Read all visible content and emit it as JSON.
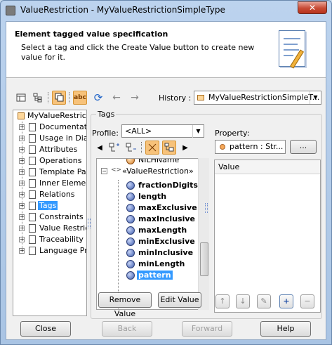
{
  "window": {
    "title": "ValueRestriction - MyValueRestrictionSimpleType",
    "close_glyph": "✕"
  },
  "header": {
    "title": "Element tagged value specification",
    "description": "Select a tag and click the Create Value button to create new value for it."
  },
  "toolbar": {
    "history_label": "History :",
    "history_value": "MyValueRestrictionSimpleT...",
    "abc_label": "abc"
  },
  "tree": {
    "root": "MyValueRestrictio",
    "items": [
      {
        "label": "Documentatio"
      },
      {
        "label": "Usage in Diag"
      },
      {
        "label": "Attributes"
      },
      {
        "label": "Operations"
      },
      {
        "label": "Template Para"
      },
      {
        "label": "Inner Element"
      },
      {
        "label": "Relations"
      },
      {
        "label": "Tags"
      },
      {
        "label": "Constraints"
      },
      {
        "label": "Value Restrict"
      },
      {
        "label": "Traceability"
      },
      {
        "label": "Language Pro"
      }
    ],
    "selected": "Tags"
  },
  "tags": {
    "group_title": "Tags",
    "profile_label": "Profile:",
    "profile_value": "<ALL>",
    "partial_item": "NILHName",
    "stereotype": "«ValueRestriction»",
    "items": [
      {
        "label": "fractionDigits"
      },
      {
        "label": "length"
      },
      {
        "label": "maxExclusive"
      },
      {
        "label": "maxInclusive"
      },
      {
        "label": "maxLength"
      },
      {
        "label": "minExclusive"
      },
      {
        "label": "minInclusive"
      },
      {
        "label": "minLength"
      },
      {
        "label": "pattern"
      }
    ],
    "selected": "pattern",
    "remove_button": "Remove Value",
    "edit_button": "Edit Value"
  },
  "property": {
    "label": "Property:",
    "value": "pattern : Str...",
    "more_button": "...",
    "column_header": "Value"
  },
  "footer": {
    "close": "Close",
    "back": "Back",
    "forward": "Forward",
    "help": "Help"
  }
}
